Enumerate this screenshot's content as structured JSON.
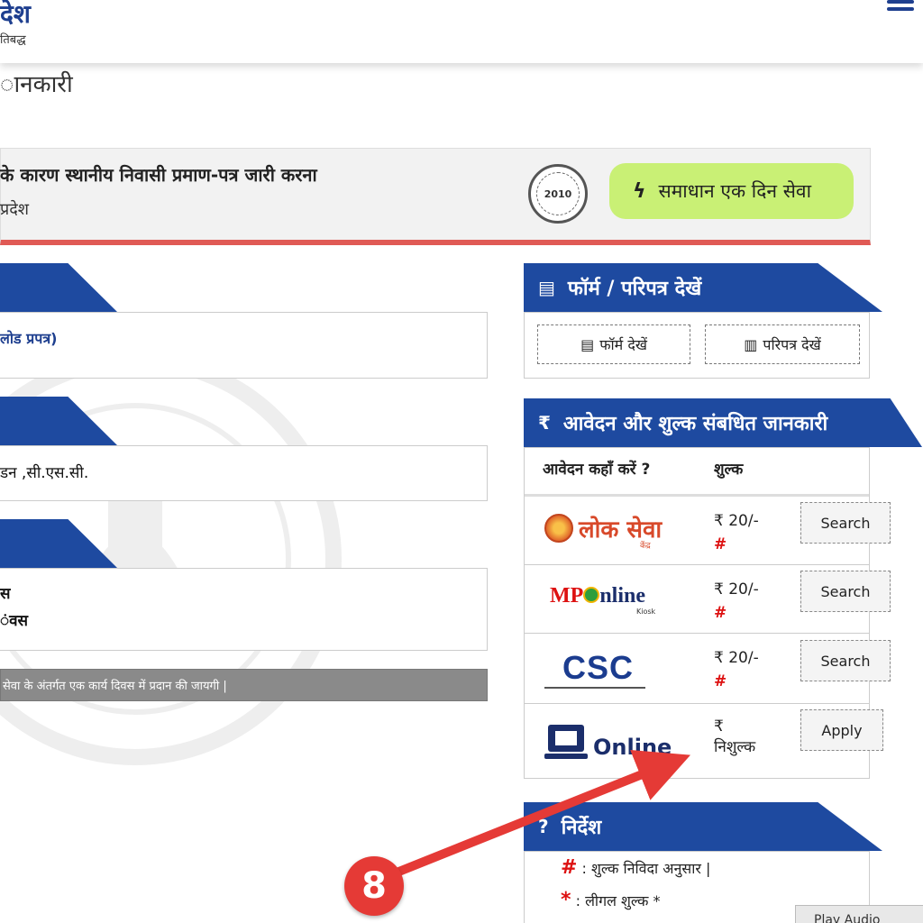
{
  "header": {
    "brand_title": "देश",
    "brand_subtitle": "तिबद्ध"
  },
  "page_heading": "ानकारी",
  "service": {
    "name": "के कारण स्थानीय निवासी प्रमाण-पत्र जारी करना",
    "department": "प्रदेश",
    "seal_year": "2010",
    "samadhan_label": "समाधान एक दिन सेवा"
  },
  "left_sections": {
    "download_text": "लोड प्रपत्र)",
    "where_text": "डन ,सी.एस.सी.",
    "time_line1": "स",
    "time_line2": "ंवस",
    "note": "सेवा के अंतर्गत एक कार्य दिवस में प्रदान की जायगी |"
  },
  "forms_panel": {
    "title": "फॉर्म / परिपत्र देखें",
    "form_button": "फॉर्म देखें",
    "circular_button": "परिपत्र देखें"
  },
  "fee_panel": {
    "title": "आवेदन और शुल्क संबधित जानकारी",
    "rupee_icon": "₹",
    "col_where": "आवेदन कहाँ करें ?",
    "col_fee": "शुल्क",
    "rows": [
      {
        "provider": "लोक सेवा",
        "fee": "₹ 20/-",
        "mark": "#",
        "action": "Search"
      },
      {
        "provider": "MPOnline",
        "fee": "₹ 20/-",
        "mark": "#",
        "action": "Search"
      },
      {
        "provider": "CSC",
        "fee": "₹ 20/-",
        "mark": "#",
        "action": "Search"
      },
      {
        "provider": "Online",
        "fee_symbol": "₹",
        "fee": "निशुल्क",
        "action": "Apply"
      }
    ],
    "mp_kiosk": "Kiosk",
    "lok_suffix": "केंद्र"
  },
  "nirdesh_panel": {
    "title": "निर्देश",
    "items": [
      {
        "mark": "#",
        "text": ": शुल्क निविदा अनुसार |"
      },
      {
        "mark": "*",
        "text": ": लीगल शुल्क *"
      }
    ]
  },
  "play_audio": "Play Audio",
  "annotation": {
    "step_number": "8",
    "color": "#e53a36"
  },
  "colors": {
    "primary_blue": "#1e4aa0",
    "accent_green": "#c9f075",
    "accent_red": "#e05a55"
  }
}
